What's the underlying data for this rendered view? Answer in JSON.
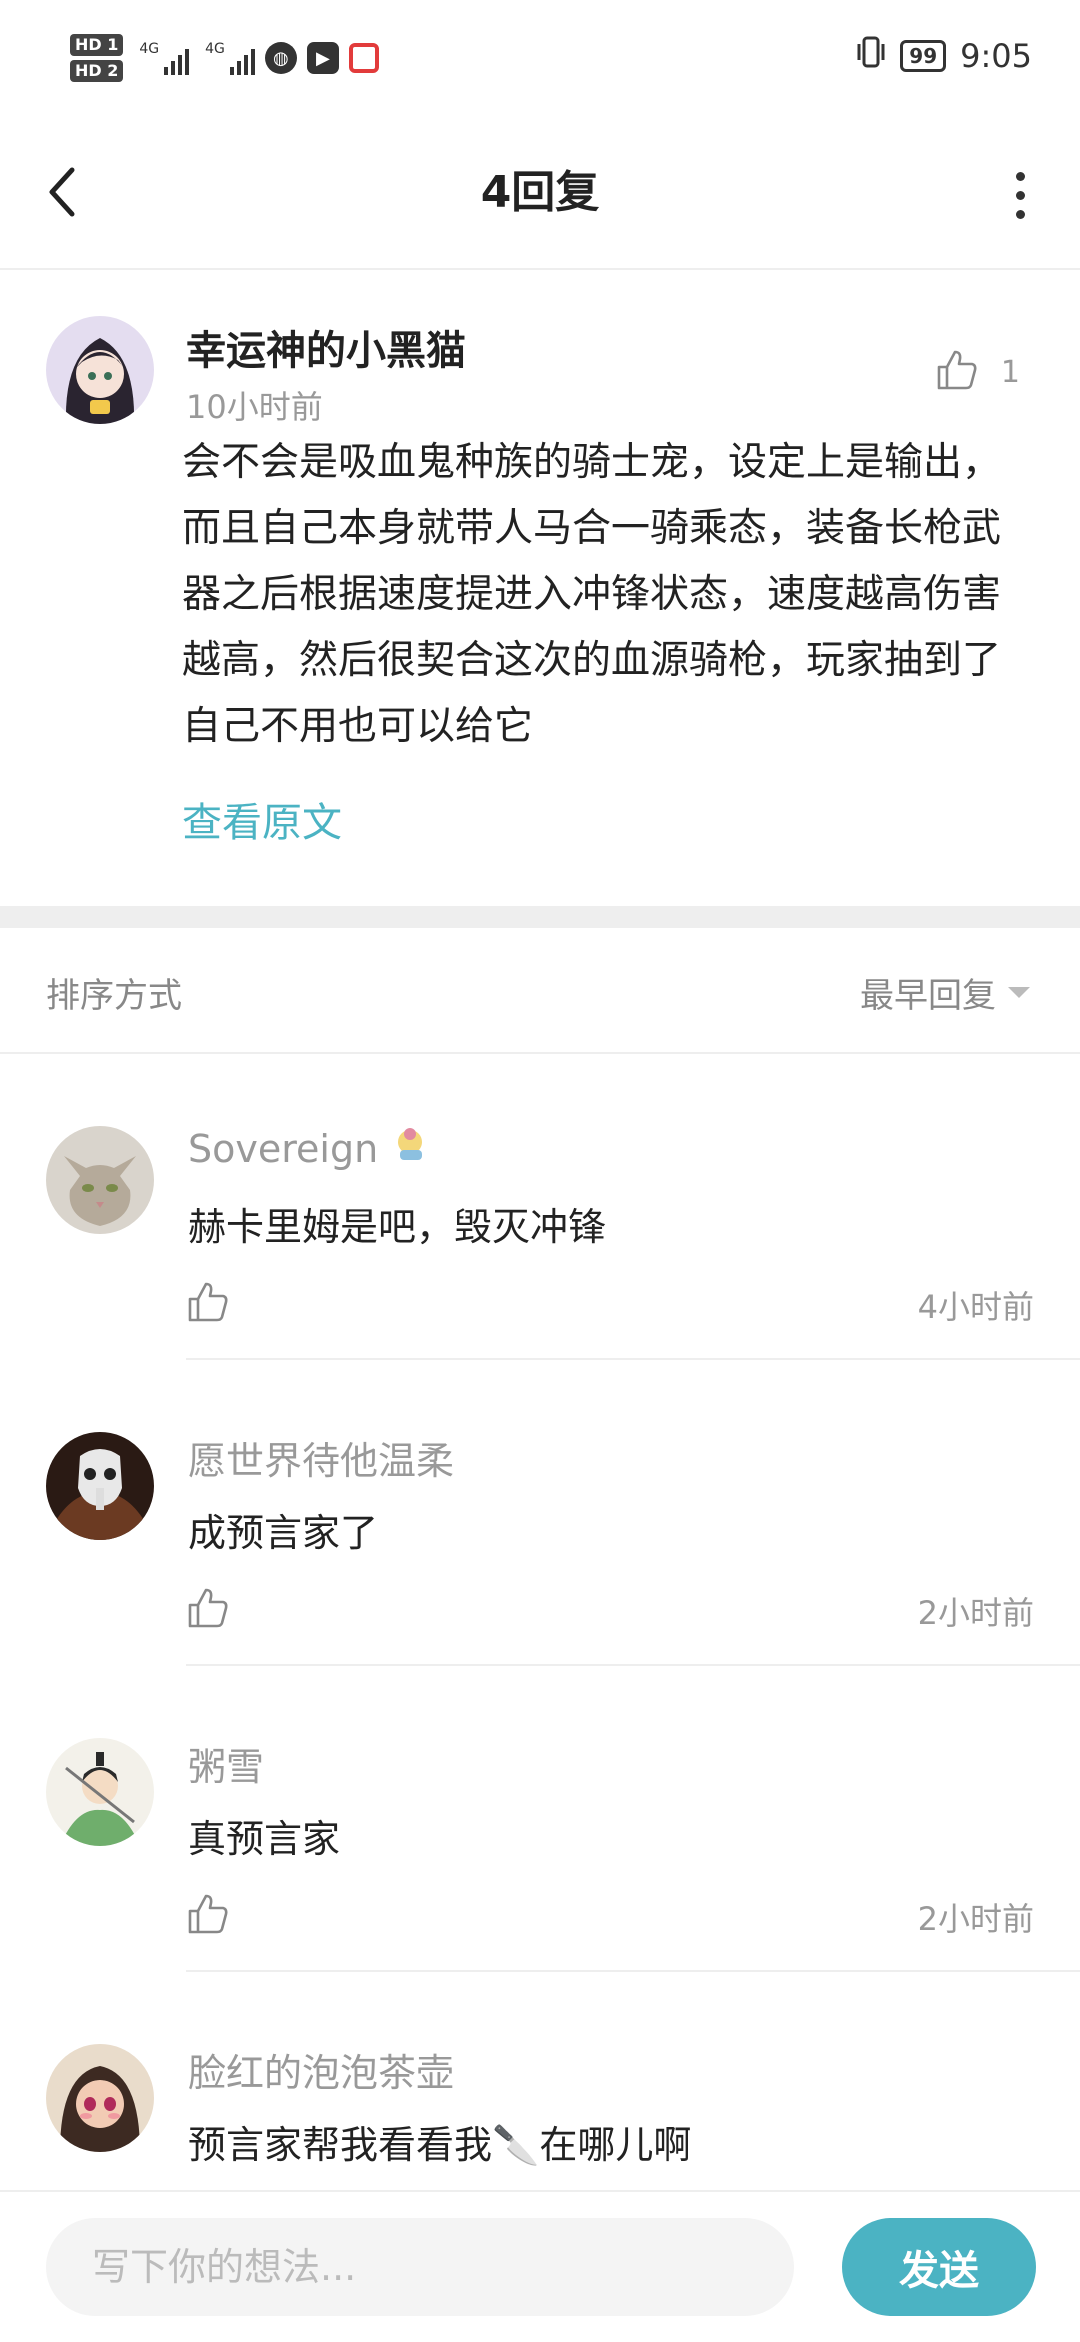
{
  "status_bar": {
    "hd1": "HD 1",
    "hd2": "HD 2",
    "net1": "4G",
    "net2": "4G",
    "battery": "99",
    "time": "9:05"
  },
  "header": {
    "title": "4回复"
  },
  "main_comment": {
    "author": "幸运神的小黑猫",
    "time": "10小时前",
    "likes": "1",
    "text": "会不会是吸血鬼种族的骑士宠，设定上是输出，而且自己本身就带人马合一骑乘态，装备长枪武器之后根据速度提进入冲锋状态，速度越高伤害越高，然后很契合这次的血源骑枪，玩家抽到了自己不用也可以给它",
    "view_original": "查看原文"
  },
  "sort": {
    "label": "排序方式",
    "value": "最早回复"
  },
  "replies": [
    {
      "author": "Sovereign",
      "text": "赫卡里姆是吧，毁灭冲锋",
      "time": "4小时前"
    },
    {
      "author": "愿世界待他温柔",
      "text": "成预言家了",
      "time": "2小时前"
    },
    {
      "author": "粥雪",
      "text": "真预言家",
      "time": "2小时前"
    },
    {
      "author": "脸红的泡泡茶壶",
      "text": "预言家帮我看看我🔪在哪儿啊",
      "time": ""
    }
  ],
  "bottom": {
    "placeholder": "写下你的想法...",
    "send": "发送"
  },
  "colors": {
    "accent": "#4bb3c3"
  }
}
